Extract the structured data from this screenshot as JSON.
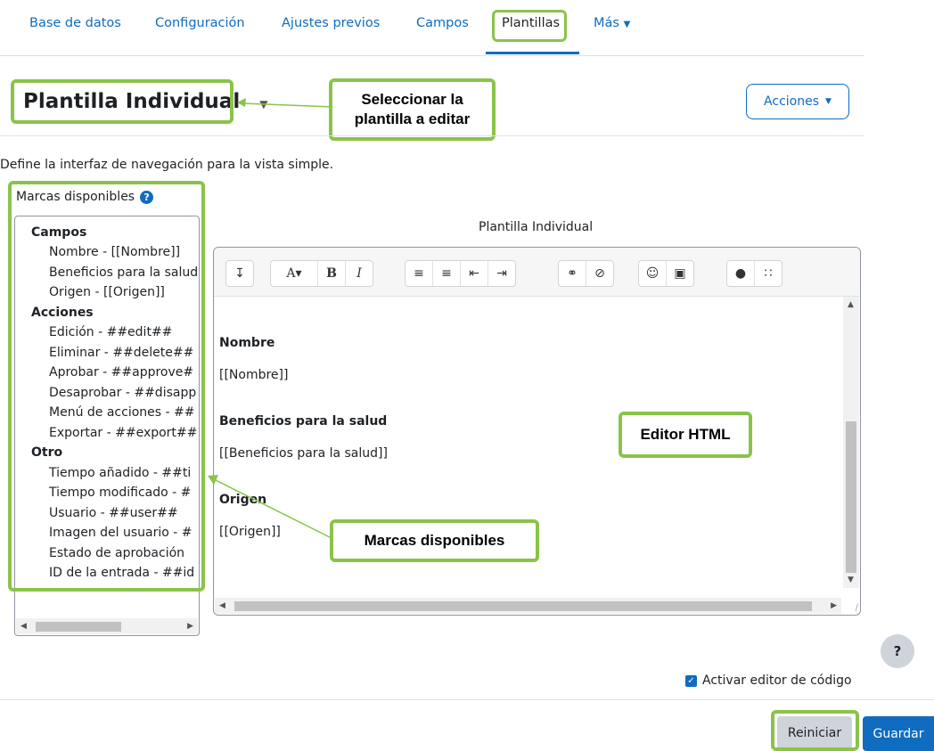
{
  "nav": {
    "items": [
      "Base de datos",
      "Configuración",
      "Ajustes previos",
      "Campos",
      "Plantillas",
      "Más"
    ],
    "active": "Plantillas"
  },
  "header": {
    "title": "Plantilla Individual",
    "actions_label": "Acciones"
  },
  "description": "Define la interfaz de navegación para la vista simple.",
  "tags": {
    "label": "Marcas disponibles",
    "groups": [
      {
        "title": "Campos",
        "items": [
          "Nombre - [[Nombre]]",
          "Beneficios para la salud",
          "Origen - [[Origen]]"
        ]
      },
      {
        "title": "Acciones",
        "items": [
          "Edición - ##edit##",
          "Eliminar - ##delete##",
          "Aprobar - ##approve#",
          "Desaprobar - ##disapp",
          "Menú de acciones - ##",
          "Exportar - ##export##"
        ]
      },
      {
        "title": "Otro",
        "items": [
          "Tiempo añadido - ##ti",
          "Tiempo modificado - #",
          "Usuario - ##user##",
          "Imagen del usuario - #",
          "Estado de aprobación",
          "ID de la entrada - ##id"
        ]
      }
    ]
  },
  "editor": {
    "title": "Plantilla Individual",
    "content": {
      "f1_label": "Nombre",
      "f1_value": "[[Nombre]]",
      "f2_label": "Beneficios para la salud",
      "f2_value": "[[Beneficios para la salud]]",
      "f3_label": "Origen",
      "f3_value": "[[Origen]]"
    },
    "toolbar_icons": [
      "collapse-icon",
      "font-style-icon",
      "bold-icon",
      "italic-icon",
      "unordered-list-icon",
      "ordered-list-icon",
      "outdent-icon",
      "indent-icon",
      "link-icon",
      "unlink-icon",
      "emoji-icon",
      "image-icon",
      "accessibility-icon",
      "screenreader-icon"
    ]
  },
  "annotations": {
    "select_template": "Seleccionar la plantilla a editar",
    "select_template_l1": "Seleccionar la",
    "select_template_l2": "plantilla a editar",
    "editor_html": "Editor HTML",
    "available_tags": "Marcas disponibles"
  },
  "footer": {
    "help": "?",
    "code_editor_label": "Activar editor de código",
    "code_editor_checked": true,
    "reset_label": "Reiniciar",
    "save_label": "Guardar"
  },
  "colors": {
    "primary": "#0f6cbf",
    "highlight": "#8bc34a",
    "secondary_btn": "#ced4da"
  }
}
